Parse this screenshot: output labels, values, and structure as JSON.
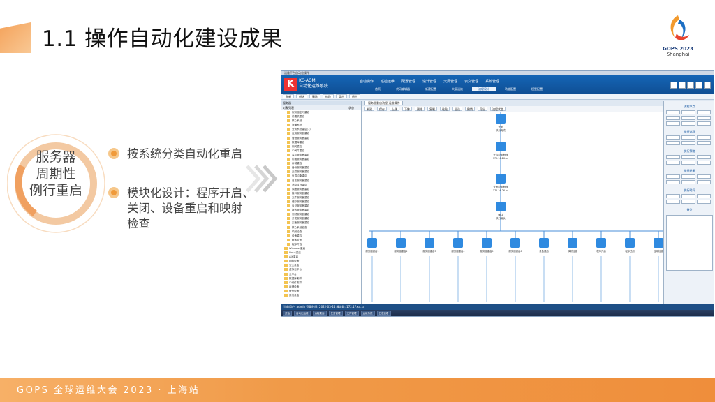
{
  "slide": {
    "title": "1.1 操作自动化建设成果",
    "logo_name": "GOPS 2023",
    "logo_city": "Shanghai",
    "circle_label": [
      "服务器",
      "周期性",
      "例行重启"
    ],
    "bullets": [
      [
        "按系统分类自动化重启"
      ],
      [
        "模块化设计：程序开启、",
        "关闭、设备重启和映射",
        "检查"
      ]
    ],
    "footer": "GOPS 全球运维大会 2023 · 上海站",
    "accent_color": "#f09a3a"
  },
  "app": {
    "window_title": "运维平台自动化操作",
    "logo_letter": "K",
    "name_line1": "KC-AOM",
    "name_line2": "自动化运维系统",
    "menu": [
      "自动操作",
      "巡检运维",
      "配置管理",
      "设计管理",
      "大屏管理",
      "表交管理",
      "系统管理"
    ],
    "submenu": [
      "首页",
      "代码编辑器",
      "新建配置",
      "大屏运维",
      "流程设计",
      "功能配置",
      "模型配置"
    ],
    "submenu_active": 4,
    "toolbar": [
      "刷新",
      "新增",
      "删除",
      "修改",
      "导出",
      "退出"
    ],
    "left_panel_title": "服务器",
    "left_panel_header": [
      "对象列表",
      "状态"
    ],
    "tree": [
      "服务器定时重启",
      "前置机重启",
      "核心系统",
      "渠道系统",
      "业务系统重启(1)",
      "应用服务器重启",
      "管理服务器重启",
      "数据库重启",
      "网关重启",
      "中间件重启",
      "监控服务器重启",
      "前置服务器重启",
      "存储重启",
      "备份服务器重启",
      "交易服务器重启",
      "负载均衡重启",
      "日志服务器重启",
      "消息队列重启",
      "调度服务器重启",
      "接口服务器重启",
      "文件服务器重启",
      "缓存服务器重启",
      "认证服务器重启",
      "报表服务器重启",
      "测试服务器重启",
      "开发服务器重启",
      "灾备服务器重启",
      "核心系统检查",
      "映射检查",
      "设备重启",
      "程序关闭",
      "程序开启",
      "Windows重启",
      "Linux重启",
      "AIX重启",
      "网络设备",
      "安全设备",
      "虚拟化平台",
      "云平台",
      "数据库集群",
      "中间件集群",
      "存储设备",
      "备份设备",
      "其他设备"
    ],
    "canvas_tab": "服务器重启流程-运维操作",
    "canvas_tools": [
      "新建",
      "保存",
      "上移",
      "下移",
      "删除",
      "复制",
      "粘贴",
      "全选",
      "撤销",
      "导出",
      "流程状态"
    ],
    "flow_nodes": [
      "开始",
      "开启应用程序",
      "关闭应用程序",
      "确认"
    ],
    "flow_node_sub": [
      "执行完成",
      "172.16.26.xx",
      "172.16.26.xx",
      "执行确认"
    ],
    "bottom_nodes": [
      "服务器重启1",
      "服务器重启2",
      "服务器重启3",
      "服务器重启4",
      "服务器重启5",
      "服务器重启6",
      "设备重启",
      "映射检查",
      "程序开启",
      "程序关闭",
      "应用检查"
    ],
    "right_panel_sections": [
      "流程节点",
      "执行选项",
      "执行策略",
      "执行结果",
      "执行时间",
      "备注"
    ],
    "statusbar": "当前用户: admin  登录时间: 2022-03-24  服务器: 172.17.xx.xx",
    "taskbar": [
      "开始",
      "自动化运维",
      "远程桌面",
      "任务管理",
      "文件管理",
      "运维系统",
      "日志查看"
    ]
  }
}
